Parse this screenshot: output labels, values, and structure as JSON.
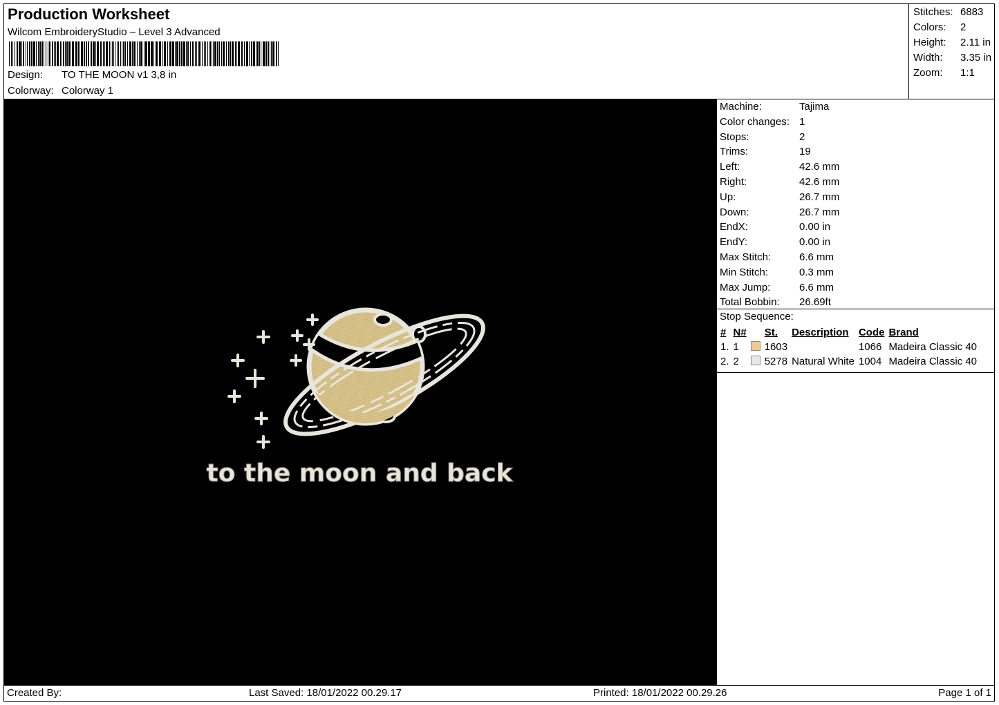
{
  "header": {
    "title": "Production Worksheet",
    "software": "Wilcom EmbroideryStudio – Level 3 Advanced",
    "design_label": "Design:",
    "design_value": "TO THE MOON v1 3,8 in",
    "colorway_label": "Colorway:",
    "colorway_value": "Colorway 1"
  },
  "summary": [
    {
      "label": "Stitches:",
      "value": "6883"
    },
    {
      "label": "Colors:",
      "value": "2"
    },
    {
      "label": "Height:",
      "value": "2.11 in"
    },
    {
      "label": "Width:",
      "value": "3.35 in"
    },
    {
      "label": "Zoom:",
      "value": "1:1"
    }
  ],
  "preview": {
    "caption": "to the moon and back",
    "background": "#000000",
    "thread_gold": "#d9c48c",
    "thread_white": "#e8e6dc"
  },
  "stats": [
    {
      "label": "Machine:",
      "value": "Tajima"
    },
    {
      "label": "Color changes:",
      "value": "1"
    },
    {
      "label": "Stops:",
      "value": "2"
    },
    {
      "label": "Trims:",
      "value": "19"
    },
    {
      "label": "Left:",
      "value": "42.6 mm"
    },
    {
      "label": "Right:",
      "value": "42.6 mm"
    },
    {
      "label": "Up:",
      "value": "26.7 mm"
    },
    {
      "label": "Down:",
      "value": "26.7 mm"
    },
    {
      "label": "EndX:",
      "value": "0.00 in"
    },
    {
      "label": "EndY:",
      "value": "0.00 in"
    },
    {
      "label": "Max Stitch:",
      "value": "6.6 mm"
    },
    {
      "label": "Min Stitch:",
      "value": "0.3 mm"
    },
    {
      "label": "Max Jump:",
      "value": "6.6 mm"
    },
    {
      "label": "Total Bobbin:",
      "value": "26.69ft"
    }
  ],
  "stop_sequence": {
    "title": "Stop Sequence:",
    "columns": [
      "#",
      "N#",
      "St.",
      "Description",
      "Code",
      "Brand"
    ],
    "rows": [
      {
        "num": "1.",
        "n": "1",
        "color": "#f6c98e",
        "st": "1603",
        "description": "",
        "code": "1066",
        "brand": "Madeira Classic 40"
      },
      {
        "num": "2.",
        "n": "2",
        "color": "#e8e8e8",
        "st": "5278",
        "description": "Natural White",
        "code": "1004",
        "brand": "Madeira Classic 40"
      }
    ]
  },
  "footer": {
    "created_by": "Created By:",
    "last_saved": "Last Saved: 18/01/2022 00.29.17",
    "printed": "Printed: 18/01/2022 00.29.26",
    "page": "Page 1 of 1"
  }
}
